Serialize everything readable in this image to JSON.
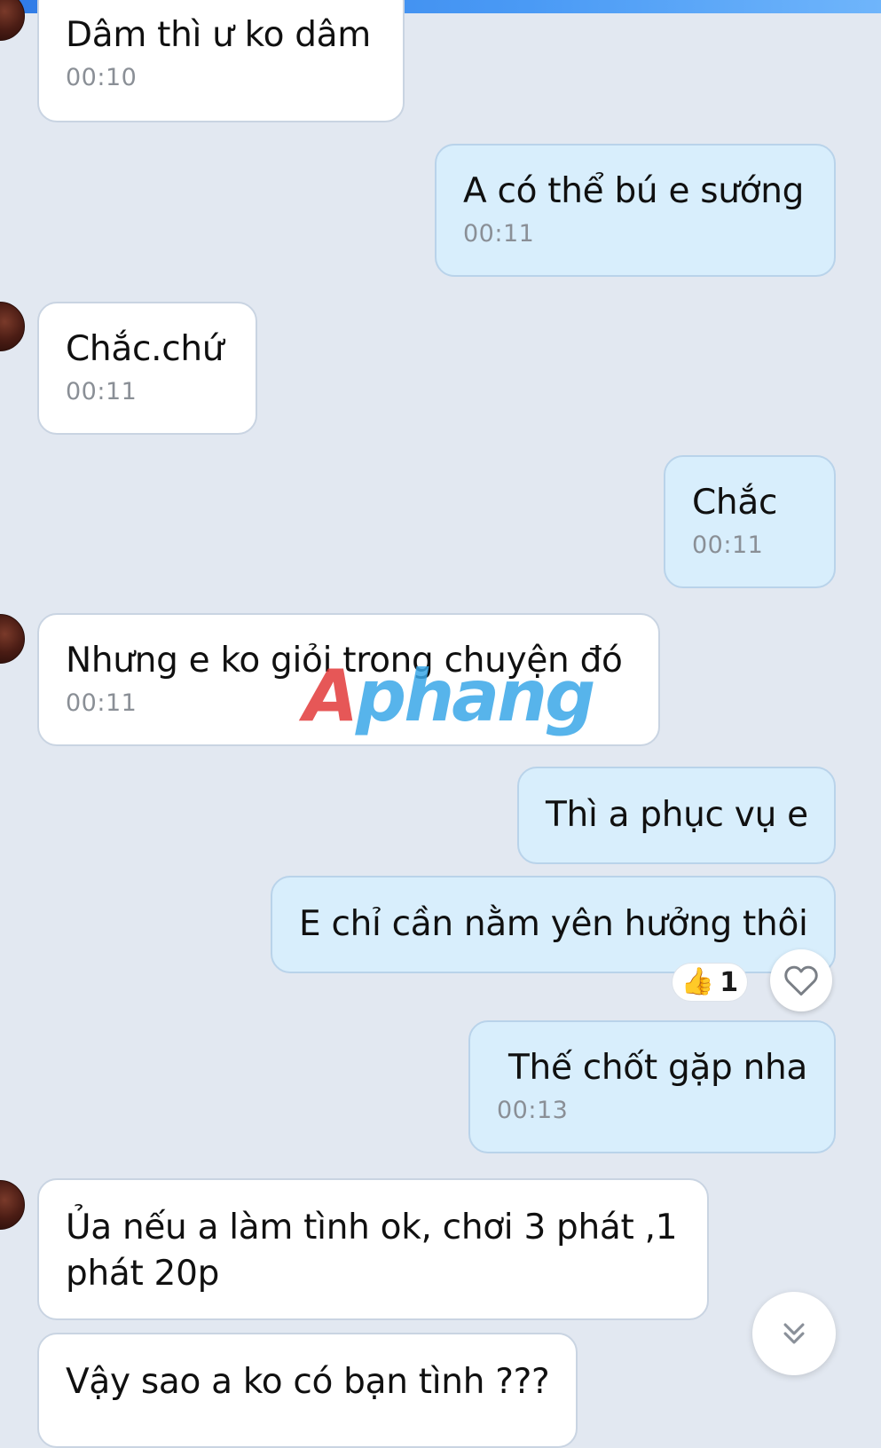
{
  "messages": [
    {
      "side": "in",
      "text": "Dâm thì ư ko dâm",
      "time": "00:10"
    },
    {
      "side": "out",
      "text": "A có thể bú e sướng",
      "time": "00:11"
    },
    {
      "side": "in",
      "text": "Chắc.chứ",
      "time": "00:11"
    },
    {
      "side": "out",
      "text": "Chắc",
      "time": "00:11"
    },
    {
      "side": "in",
      "text": "Nhưng e ko giỏi trong chuyện đó",
      "time": "00:11"
    },
    {
      "side": "out",
      "text": "Thì a phục vụ e"
    },
    {
      "side": "out",
      "text": "E chỉ cần nằm yên hưởng thôi",
      "reaction": {
        "emoji": "👍",
        "count": "1"
      }
    },
    {
      "side": "out",
      "text": "Thế chốt gặp nha",
      "time": "00:13"
    },
    {
      "side": "in",
      "text": "Ủa nếu a làm tình ok, chơi 3 phát ,1 phát 20p"
    },
    {
      "side": "in",
      "text": "Vậy sao a ko có bạn tình ???"
    }
  ],
  "watermark": {
    "first": "A",
    "rest": "phang"
  },
  "icons": {
    "heart": "heart-outline-icon",
    "scroll": "chevron-double-down-icon",
    "reaction": "thumbs-up-icon"
  },
  "colors": {
    "background": "#e2e8f1",
    "incoming": "#ffffff",
    "outgoing": "#d8eefc",
    "accent": "#2f7be6"
  }
}
